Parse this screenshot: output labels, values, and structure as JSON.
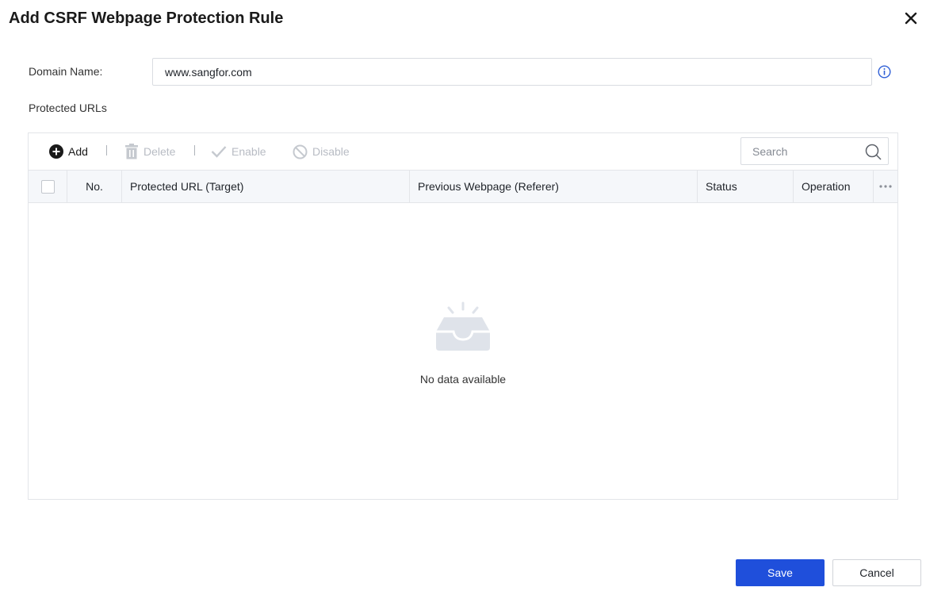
{
  "dialog": {
    "title": "Add CSRF Webpage Protection Rule"
  },
  "form": {
    "domain_label": "Domain Name:",
    "domain_value": "www.sangfor.com",
    "protected_urls_label": "Protected URLs"
  },
  "toolbar": {
    "add_label": "Add",
    "delete_label": "Delete",
    "enable_label": "Enable",
    "disable_label": "Disable",
    "search_placeholder": "Search"
  },
  "table": {
    "columns": [
      "No.",
      "Protected URL (Target)",
      "Previous Webpage (Referer)",
      "Status",
      "Operation"
    ],
    "rows": [],
    "empty_text": "No data available"
  },
  "footer": {
    "save_label": "Save",
    "cancel_label": "Cancel"
  },
  "colors": {
    "primary": "#1f4fdb",
    "disabled": "#b8bcc4",
    "info": "#2f5fd6"
  },
  "icons": [
    "close-icon",
    "info-icon",
    "add-icon",
    "trash-icon",
    "check-icon",
    "ban-icon",
    "search-icon",
    "more-icon",
    "empty-inbox-icon"
  ]
}
